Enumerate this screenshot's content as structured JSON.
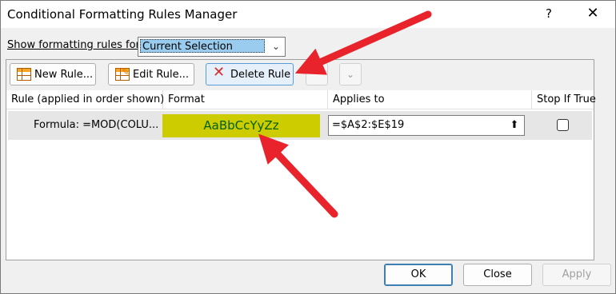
{
  "window": {
    "title": "Conditional Formatting Rules Manager",
    "help": "?",
    "close": "✕"
  },
  "show_rules": {
    "label": "Show formatting rules for:",
    "selected": "Current Selection"
  },
  "toolbar": {
    "new_rule": "New Rule...",
    "edit_rule": "Edit Rule...",
    "delete_rule": "Delete Rule",
    "move_up": "⌃",
    "move_down": "⌄"
  },
  "table": {
    "headers": [
      "Rule (applied in order shown)",
      "Format",
      "Applies to",
      "Stop If True"
    ],
    "rows": [
      {
        "rule": "Formula: =MOD(COLU...",
        "format_preview": "AaBbCcYyZz",
        "applies_to": "=$A$2:$E$19",
        "stop_if_true": false
      }
    ]
  },
  "footer": {
    "ok": "OK",
    "close": "Close",
    "apply": "Apply"
  },
  "colors": {
    "format_fill": "#cccc00",
    "format_text": "#006100",
    "annotation_arrow": "#e8232b",
    "selection_highlight": "#99ccee"
  }
}
